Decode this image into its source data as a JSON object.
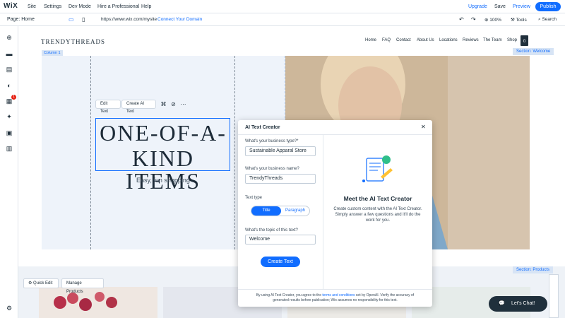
{
  "topbar": {
    "logo": "WiX",
    "menu": [
      "Site",
      "Settings",
      "Dev Mode",
      "Hire a Professional",
      "Help"
    ],
    "upgrade": "Upgrade",
    "save": "Save",
    "preview": "Preview",
    "publish": "Publish"
  },
  "secondbar": {
    "page": "Page: Home",
    "url": "https://www.wix.com/mysite",
    "connect": "Connect Your Domain",
    "zoom": "100%",
    "tools": "Tools",
    "search": "Search"
  },
  "site": {
    "brand": "TRENDYTHREADS",
    "nav": [
      "Home",
      "FAQ",
      "Contact",
      "About Us",
      "Locations",
      "Reviews",
      "The Team",
      "Shop"
    ],
    "cart_count": "0",
    "column_tag": "Column 1",
    "section_welcome": "Section: Welcome",
    "section_products": "Section: Products",
    "heading_line1": "ONE-OF-A-",
    "heading_line2": "KIND ITEMS",
    "subheading": "Easy, fun shopping",
    "edit_text": "Edit Text",
    "create_ai_text": "Create AI Text",
    "quick_edit": "Quick Edit",
    "manage_products": "Manage Products",
    "chat": "Let's Chat!"
  },
  "modal": {
    "title": "AI Text Creator",
    "q_business_type": "What's your business type?*",
    "business_type": "Sustainable Apparal Store",
    "q_business_name": "What's your business name?",
    "business_name": "TrendyThreads",
    "q_text_type": "Text type",
    "text_type_options": [
      "Title",
      "Paragraph"
    ],
    "selected_text_type": "Title",
    "q_topic": "What's the topic of this text?",
    "topic": "Welcome",
    "create_button": "Create Text",
    "meet_title": "Meet the AI Text Creator",
    "meet_desc": "Create custom content with the AI Text Creator. Simply answer a few questions and it'll do the work for you.",
    "footer_pre": "By using AI Text Creator, you agree to the",
    "footer_link": "terms and conditions",
    "footer_post": "set by OpenAI. Verify the accuracy of generated results before publication; Wix assumes no responsibility for this text."
  },
  "colors": {
    "accent": "#116dff",
    "dark": "#20303c",
    "section_bg": "#e7eef8"
  },
  "icons": [
    "desktop-icon",
    "mobile-icon",
    "undo-icon",
    "redo-icon",
    "zoom-icon",
    "tools-icon",
    "search-icon",
    "close-icon",
    "cart-icon",
    "chat-icon"
  ]
}
